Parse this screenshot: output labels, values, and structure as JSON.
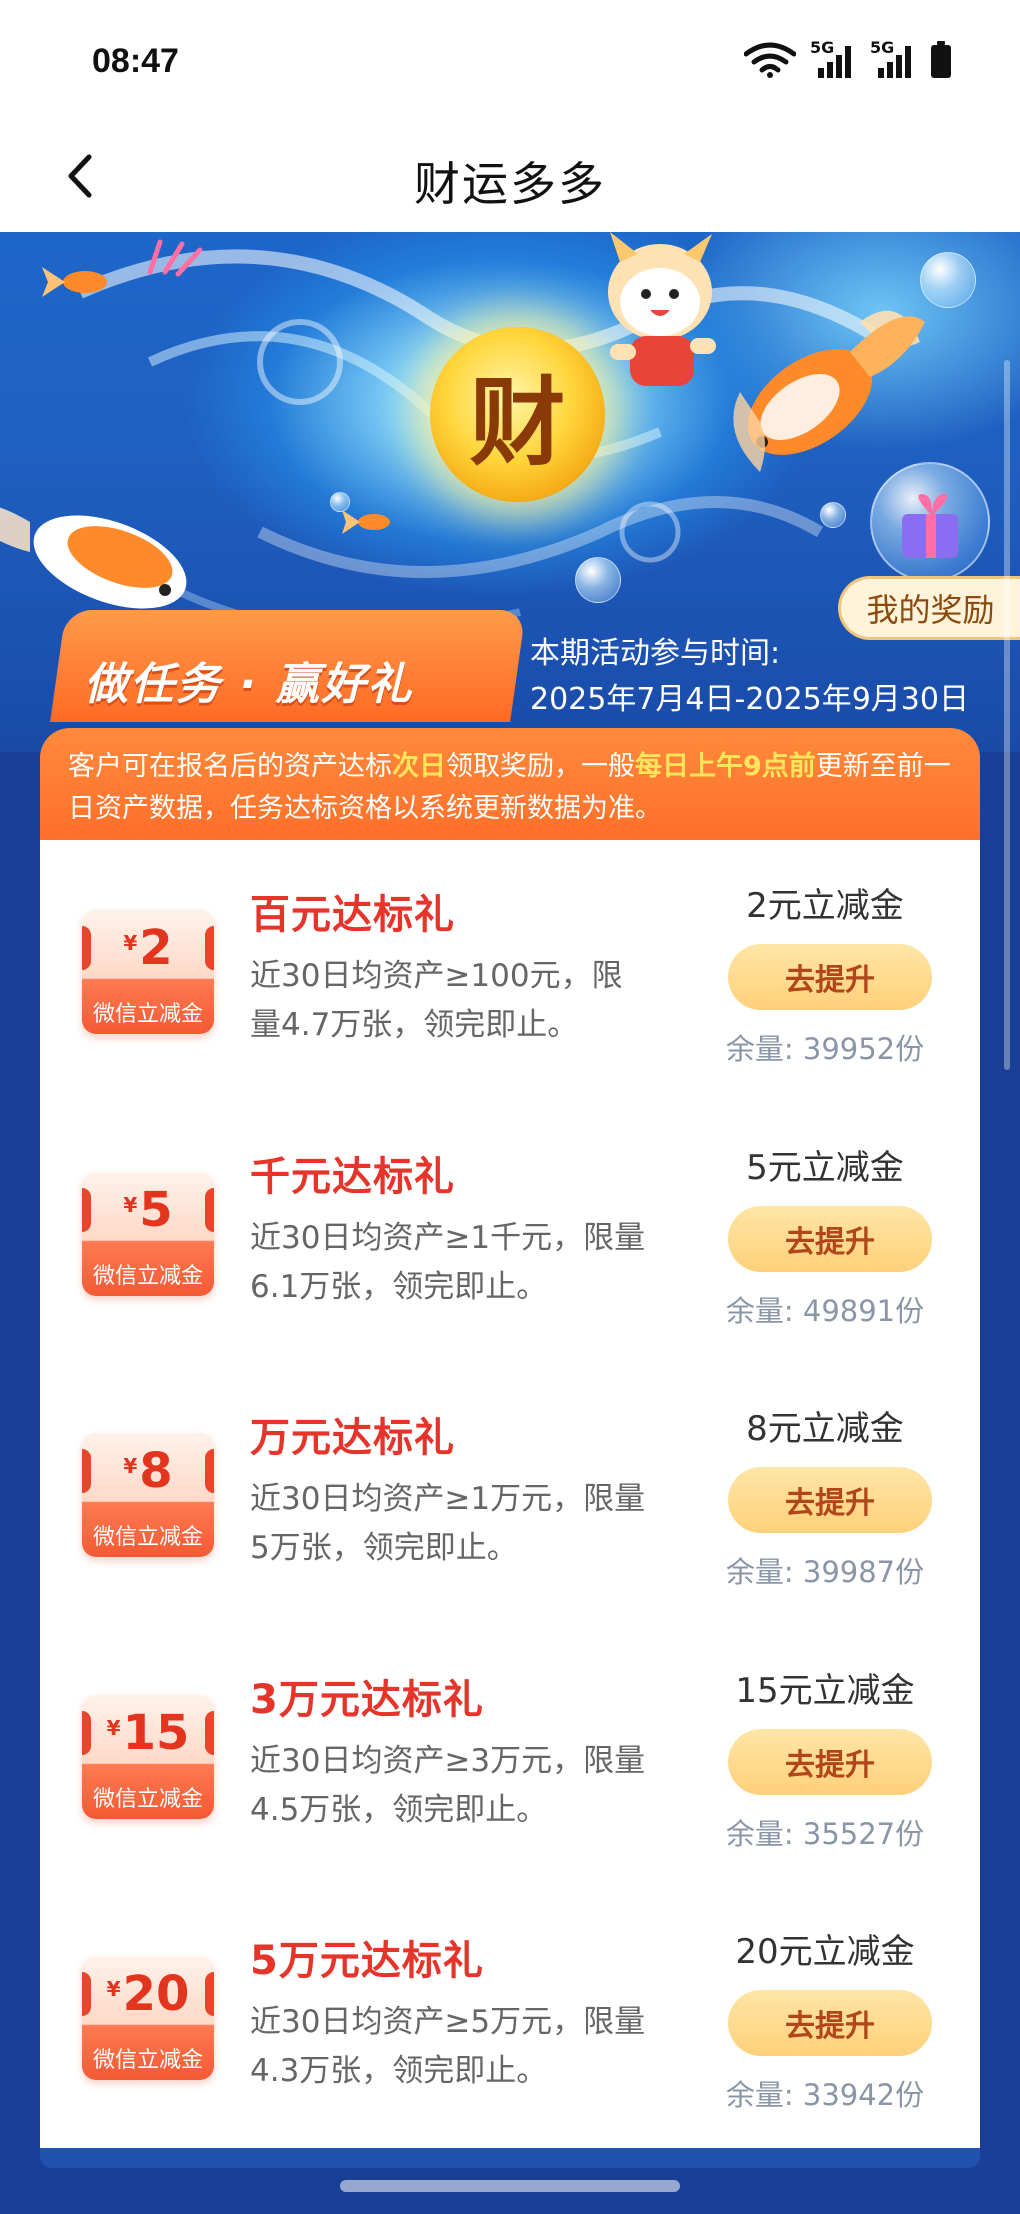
{
  "status": {
    "time": "08:47",
    "network1": "5G",
    "network2": "5G"
  },
  "nav": {
    "title": "财运多多"
  },
  "hero": {
    "coin_char": "财",
    "my_reward": "我的奖励",
    "task_banner": "做任务 · 赢好礼",
    "period_label": "本期活动参与时间:",
    "period_value": "2025年7月4日-2025年9月30日"
  },
  "notice": {
    "part1": "客户可在报名后的资产达标",
    "hl1": "次日",
    "part2": "领取奖励，一般",
    "hl2": "每日上午9点前",
    "part3": "更新至前一日资产数据，任务达标资格以系统更新数据为准。"
  },
  "currency_symbol": "¥",
  "tasks": [
    {
      "amount": "2",
      "coupon_label": "微信立减金",
      "title": "百元达标礼",
      "desc_line1": "近30日均资产≥100元，限",
      "desc_line2": "量4.7万张，领完即止。",
      "reward": "2元立减金",
      "button": "去提升",
      "stock": "余量: 39952份"
    },
    {
      "amount": "5",
      "coupon_label": "微信立减金",
      "title": "千元达标礼",
      "desc_line1": "近30日均资产≥1千元，限量",
      "desc_line2": "6.1万张，领完即止。",
      "reward": "5元立减金",
      "button": "去提升",
      "stock": "余量: 49891份"
    },
    {
      "amount": "8",
      "coupon_label": "微信立减金",
      "title": "万元达标礼",
      "desc_line1": "近30日均资产≥1万元，限量",
      "desc_line2": "5万张，领完即止。",
      "reward": "8元立减金",
      "button": "去提升",
      "stock": "余量: 39987份"
    },
    {
      "amount": "15",
      "coupon_label": "微信立减金",
      "title": "3万元达标礼",
      "desc_line1": "近30日均资产≥3万元，限量",
      "desc_line2": "4.5万张，领完即止。",
      "reward": "15元立减金",
      "button": "去提升",
      "stock": "余量: 35527份"
    },
    {
      "amount": "20",
      "coupon_label": "微信立减金",
      "title": "5万元达标礼",
      "desc_line1": "近30日均资产≥5万元，限量",
      "desc_line2": "4.3万张，领完即止。",
      "reward": "20元立减金",
      "button": "去提升",
      "stock": "余量: 33942份"
    }
  ],
  "icons": {
    "back": "chevron-left-icon",
    "wifi": "wifi-icon",
    "signal": "signal-icon",
    "battery": "battery-icon"
  },
  "colors": {
    "page_bg": "#1a3f96",
    "title_red": "#e5352b",
    "notice_orange": "#ff7a30",
    "highlight_yellow": "#ffe55c",
    "button_gold": "#ffd07a",
    "stock_gray": "#8a96a8"
  }
}
